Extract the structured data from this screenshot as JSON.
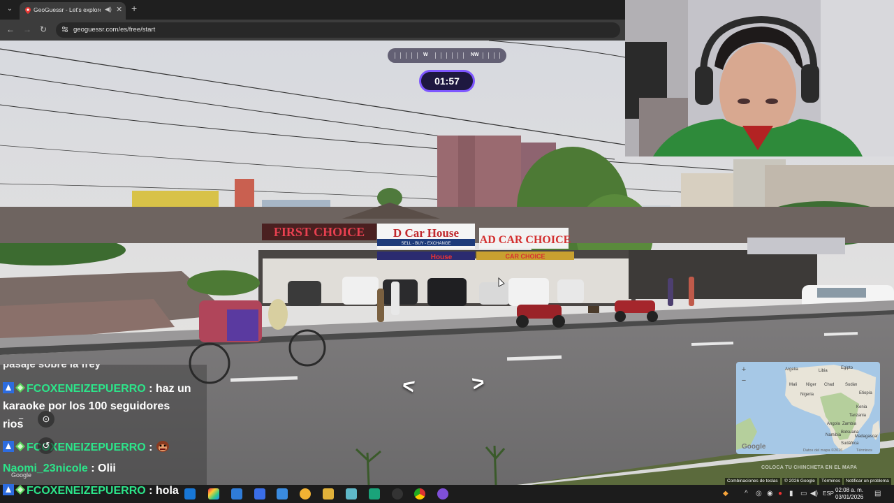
{
  "browser": {
    "tab_title": "GeoGuessr - Let's explore the world!",
    "tab_audio_icon": "speaker-icon",
    "url": "geoguessr.com/es/free/start"
  },
  "game": {
    "compass_labels": [
      "W",
      "NW"
    ],
    "timer": "01:57"
  },
  "chat": {
    "cut_text": "pasaje sobre la frey",
    "messages": [
      {
        "user": "FCOXENEIZEPUERRO",
        "sep": " : ",
        "text": "haz un karaoke por los 100 seguidores rios",
        "text_line1": "haz un",
        "text_line2": "karaoke por los 100 seguidores",
        "text_line3": "rios"
      },
      {
        "user": "FCOXENEIZEPUERRO",
        "sep": " : ",
        "text": "",
        "emote": "monkey-face-emote"
      },
      {
        "user": "Naomi_23nicole",
        "sep": " : ",
        "text": "Olii"
      },
      {
        "user": "FCOXENEIZEPUERRO",
        "sep": " : ",
        "text": "hola"
      }
    ]
  },
  "streetview": {
    "google_mark": "Google",
    "signs": [
      "FIRST CHOICE",
      "D Car House",
      "AD CAR CHOICE",
      "House",
      "CAR CHOICE"
    ],
    "sign_small": "SELL - BUY - EXCHANGE",
    "footer_shortcuts": "Combinaciones de teclas",
    "footer_copyright": "© 2026 Google",
    "footer_terms": "Términos",
    "footer_report": "Notificar un problema"
  },
  "minimap": {
    "labels": [
      "Argelia",
      "Libia",
      "Egipto",
      "Mali",
      "Níger",
      "Chad",
      "Sudán",
      "Nigeria",
      "Etiopía",
      "Kenia",
      "Tanzania",
      "Angola",
      "Namibia",
      "Botsuana",
      "Sudáfrica",
      "Madagascar",
      "Zambia"
    ],
    "footer_data": "Datos del mapa ©2026",
    "footer_terms": "Términos",
    "google": "Google",
    "place_button": "COLOCA TU CHINCHETA EN EL MAPA"
  },
  "taskbar": {
    "language": "ESP",
    "time": "02:08 a. m.",
    "date": "03/01/2026"
  },
  "colors": {
    "timer_border": "#7e57ff",
    "chat_username": "#2ce58a"
  }
}
